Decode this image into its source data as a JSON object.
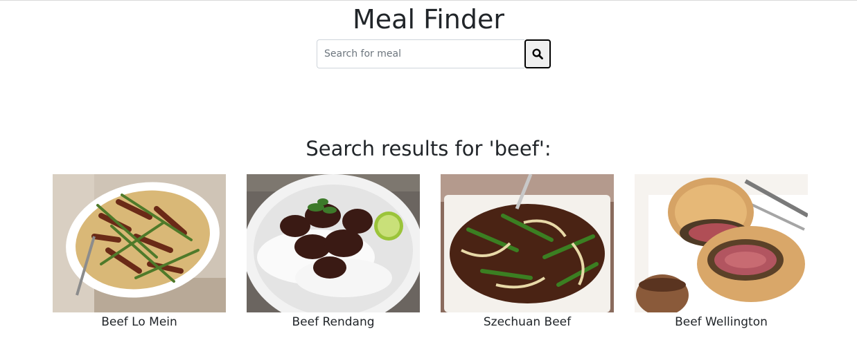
{
  "header": {
    "title": "Meal Finder"
  },
  "search": {
    "placeholder": "Search for meal",
    "value": "",
    "button_icon": "search-icon"
  },
  "results": {
    "heading": "Search results for 'beef':",
    "meals": [
      {
        "name": "Beef Lo Mein",
        "image": "stir-fried beef strips with asparagus and noodles on white oval platter"
      },
      {
        "name": "Beef Rendang",
        "image": "dark braised beef chunks with white rice and lime on white plate"
      },
      {
        "name": "Szechuan Beef",
        "image": "stir-fried beef with onions and scallions on white plate"
      },
      {
        "name": "Beef Wellington",
        "image": "sliced pastry-wrapped beef with pink center and gravy boat"
      }
    ]
  }
}
